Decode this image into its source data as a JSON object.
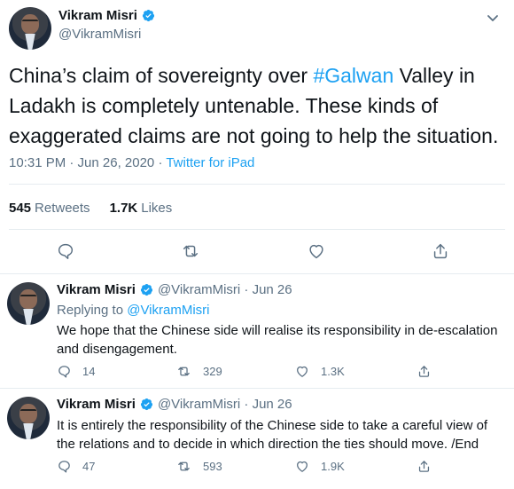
{
  "main": {
    "name": "Vikram Misri",
    "handle": "@VikramMisri",
    "text_part1": "China’s claim of sovereignty over ",
    "hashtag": "#Galwan",
    "text_part2": " Valley in Ladakh is completely untenable. These kinds of exaggerated claims are not going to help the situation.",
    "time": "10:31 PM · Jun 26, 2020 · ",
    "source": "Twitter for iPad",
    "retweets_count": "545",
    "retweets_label": "Retweets",
    "likes_count": "1.7K",
    "likes_label": "Likes"
  },
  "replies": [
    {
      "name": "Vikram Misri",
      "handle_date": "@VikramMisri · Jun 26",
      "replying_prefix": "Replying to ",
      "replying_to": "@VikramMisri",
      "text": "We hope that the Chinese side will realise its responsibility in de-escalation and disengagement.",
      "reply_count": "14",
      "retweet_count": "329",
      "like_count": "1.3K"
    },
    {
      "name": "Vikram Misri",
      "handle_date": "@VikramMisri · Jun 26",
      "text": "It is entirely the responsibility of the Chinese side to take a careful view of the relations and to decide in which direction the ties should move. /End",
      "reply_count": "47",
      "retweet_count": "593",
      "like_count": "1.9K"
    }
  ],
  "colors": {
    "accent": "#1da1f2",
    "secondary_text": "#5b7083",
    "divider": "#e6ecf0"
  },
  "icons": [
    "verified-badge-icon",
    "chevron-down-icon",
    "reply-icon",
    "retweet-icon",
    "like-icon",
    "share-icon"
  ]
}
